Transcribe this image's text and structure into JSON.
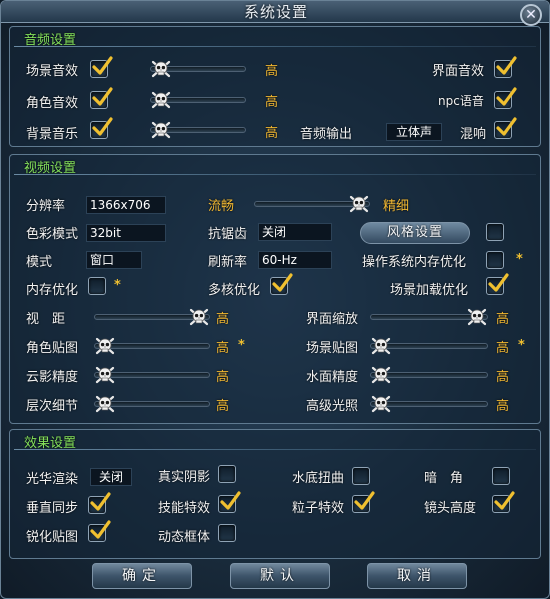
{
  "window": {
    "title": "系统设置",
    "close_glyph": "✕"
  },
  "audio": {
    "title": "音频设置",
    "scene_sound": {
      "label": "场景音效",
      "checked": true,
      "level": 0.0,
      "level_label": "高"
    },
    "role_sound": {
      "label": "角色音效",
      "checked": true,
      "level": 0.0,
      "level_label": "高"
    },
    "bg_music": {
      "label": "背景音乐",
      "checked": true,
      "level": 0.0,
      "level_label": "高"
    },
    "audio_output": {
      "label": "音频输出",
      "value": "立体声"
    },
    "ui_sound": {
      "label": "界面音效",
      "checked": true
    },
    "npc_voice": {
      "label": "npc语音",
      "checked": true
    },
    "reverb": {
      "label": "混响",
      "checked": true
    }
  },
  "video": {
    "title": "视频设置",
    "resolution": {
      "label": "分辨率",
      "value": "1366x706"
    },
    "color_mode": {
      "label": "色彩模式",
      "value": "32bit"
    },
    "mode": {
      "label": "模式",
      "value": "窗口"
    },
    "memory_opt": {
      "label": "内存优化",
      "checked": false,
      "star": "*"
    },
    "quality": {
      "left_label": "流畅",
      "right_label": "精细",
      "level": 1.0
    },
    "antialias": {
      "label": "抗锯齿",
      "value": "关闭"
    },
    "refresh_rate": {
      "label": "刷新率",
      "value": "60-Hz"
    },
    "multicore": {
      "label": "多核优化",
      "checked": true
    },
    "style_button": "风格设置",
    "style_checked": false,
    "os_memory_opt": {
      "label": "操作系统内存优化",
      "checked": false,
      "star": "*"
    },
    "scene_load_opt": {
      "label": "场景加载优化",
      "checked": true
    },
    "sliders_left": [
      {
        "label": "视　距",
        "level": 1.0,
        "value_label": "高",
        "star": ""
      },
      {
        "label": "角色贴图",
        "level": 0.0,
        "value_label": "高",
        "star": "*"
      },
      {
        "label": "云影精度",
        "level": 0.0,
        "value_label": "高",
        "star": ""
      },
      {
        "label": "层次细节",
        "level": 0.0,
        "value_label": "高",
        "star": ""
      }
    ],
    "sliders_right": [
      {
        "label": "界面缩放",
        "level": 1.0,
        "value_label": "高",
        "star": ""
      },
      {
        "label": "场景贴图",
        "level": 0.0,
        "value_label": "高",
        "star": "*"
      },
      {
        "label": "水面精度",
        "level": 0.0,
        "value_label": "高",
        "star": ""
      },
      {
        "label": "高级光照",
        "level": 0.0,
        "value_label": "高",
        "star": ""
      }
    ]
  },
  "effects": {
    "title": "效果设置",
    "bloom": {
      "label": "光华渲染",
      "value": "关闭"
    },
    "real_shadow": {
      "label": "真实阴影",
      "checked": false
    },
    "underwater": {
      "label": "水底扭曲",
      "checked": false
    },
    "vignette": {
      "label": "暗　角",
      "checked": false
    },
    "vsync": {
      "label": "垂直同步",
      "checked": true
    },
    "skill_fx": {
      "label": "技能特效",
      "checked": true
    },
    "particle_fx": {
      "label": "粒子特效",
      "checked": true
    },
    "camera_height": {
      "label": "镜头高度",
      "checked": true
    },
    "sharpen": {
      "label": "锐化贴图",
      "checked": true
    },
    "dynamic_border": {
      "label": "动态框体",
      "checked": false
    }
  },
  "buttons": {
    "ok": "确定",
    "default": "默认",
    "cancel": "取消"
  },
  "colors": {
    "section_title": "#84e05a",
    "gold": "#f0b732",
    "check": "#f0c030"
  }
}
